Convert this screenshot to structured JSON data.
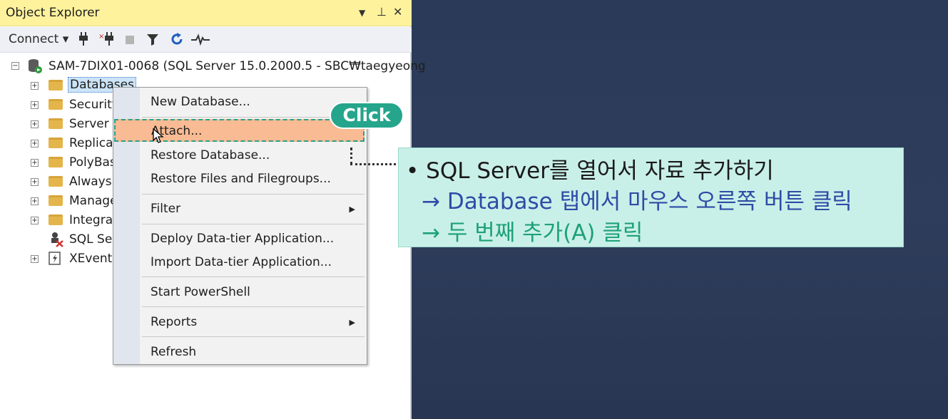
{
  "window": {
    "title": "Object Explorer",
    "controls": {
      "dropdown": "▼",
      "pin": "⊥",
      "close": "✕"
    }
  },
  "toolbar": {
    "connect_label": "Connect ▾",
    "icons": [
      "connect-plug-icon",
      "disconnect-plug-icon",
      "stop-icon",
      "filter-icon",
      "refresh-icon",
      "activity-monitor-icon"
    ]
  },
  "tree": {
    "server": "SAM-7DIX01-0068 (SQL Server 15.0.2000.5 - SBC₩taegyeong",
    "items": [
      {
        "label": "Databases",
        "icon": "folder-icon"
      },
      {
        "label": "Security",
        "icon": "folder-icon"
      },
      {
        "label": "Server O",
        "icon": "folder-icon"
      },
      {
        "label": "Replicat",
        "icon": "folder-icon"
      },
      {
        "label": "PolyBas",
        "icon": "folder-icon"
      },
      {
        "label": "Always",
        "icon": "folder-icon"
      },
      {
        "label": "Manage",
        "icon": "folder-icon"
      },
      {
        "label": "Integrat",
        "icon": "folder-icon"
      },
      {
        "label": "SQL Se",
        "icon": "sql-agent-icon"
      },
      {
        "label": "XEvent",
        "icon": "xevent-icon"
      }
    ]
  },
  "context_menu": {
    "items": [
      {
        "label": "New Database..."
      },
      {
        "label": "Attach..."
      },
      {
        "label": "Restore Database..."
      },
      {
        "label": "Restore Files and Filegroups..."
      },
      {
        "label": "Filter",
        "submenu": true
      },
      {
        "label": "Deploy Data-tier Application..."
      },
      {
        "label": "Import Data-tier Application..."
      },
      {
        "label": "Start PowerShell"
      },
      {
        "label": "Reports",
        "submenu": true
      },
      {
        "label": "Refresh"
      }
    ],
    "highlighted_item": "Attach..."
  },
  "annotation": {
    "click_badge": "Click",
    "line1": "• SQL Server를 열어서 자료 추가하기",
    "line2": "→ Database 탭에서 마우스 오른쪽 버튼 클릭",
    "line3": "→ 두 번째 추가(A) 클릭",
    "colors": {
      "callout_bg": "#c9f0e8",
      "line2": "#2e4ca6",
      "line3": "#1ea178",
      "badge": "#25a58c"
    }
  }
}
